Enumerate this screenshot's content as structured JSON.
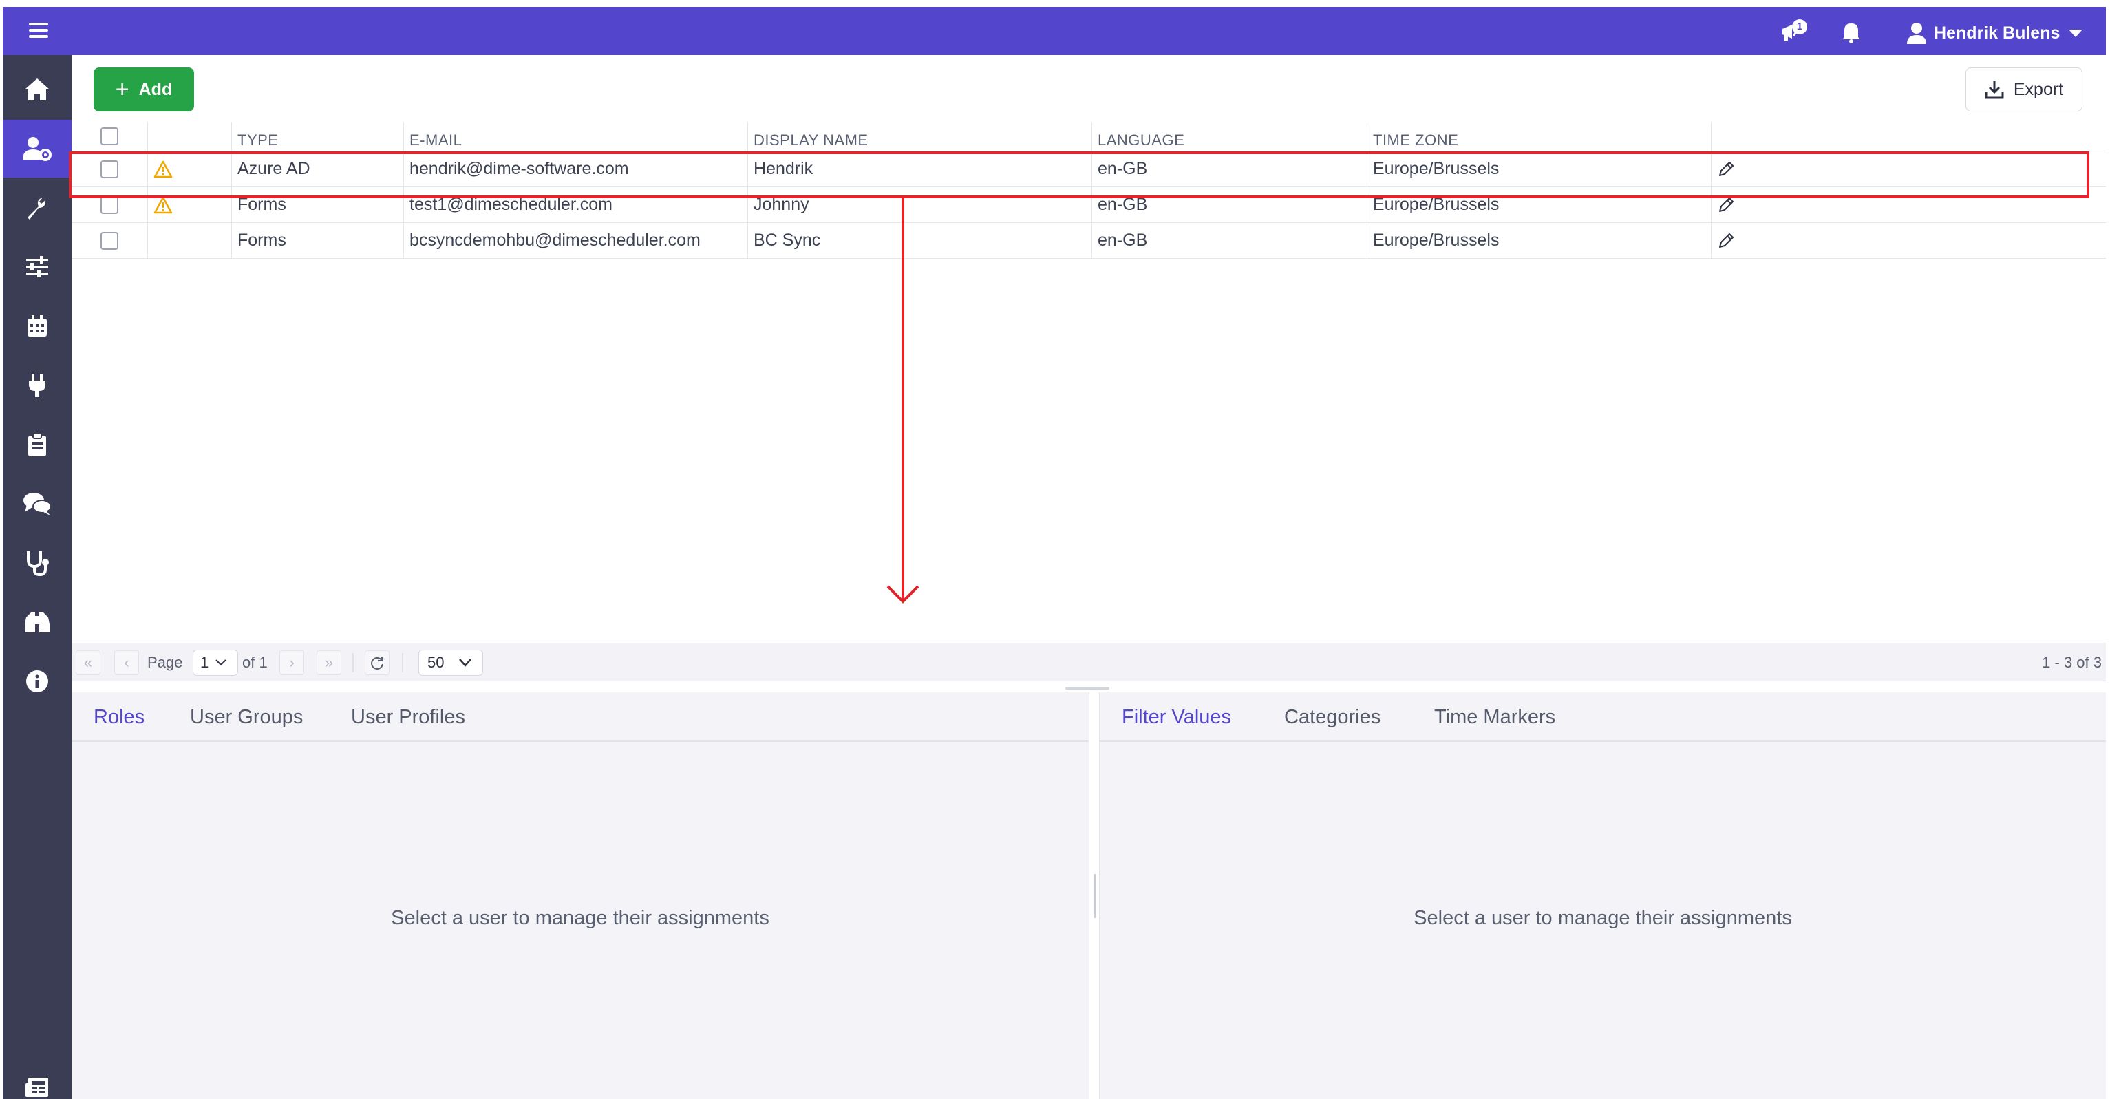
{
  "topbar": {
    "notification_count": "1",
    "user_name": "Hendrik Bulens",
    "brand_color": "#5446cc",
    "icons": [
      "menu-icon",
      "announcement-icon",
      "bell-icon",
      "user-icon",
      "caret-down-icon"
    ]
  },
  "sidebar": {
    "items": [
      {
        "icon": "home-icon",
        "active": false
      },
      {
        "icon": "user-settings-icon",
        "active": true
      },
      {
        "icon": "wrench-icon",
        "active": false
      },
      {
        "icon": "sliders-icon",
        "active": false
      },
      {
        "icon": "calendar-icon",
        "active": false
      },
      {
        "icon": "plug-icon",
        "active": false
      },
      {
        "icon": "clipboard-icon",
        "active": false
      },
      {
        "icon": "chat-icon",
        "active": false
      },
      {
        "icon": "stethoscope-icon",
        "active": false
      },
      {
        "icon": "binoculars-icon",
        "active": false
      },
      {
        "icon": "info-icon",
        "active": false
      },
      {
        "icon": "newspaper-icon",
        "active": false
      }
    ]
  },
  "toolbar": {
    "add_label": "Add",
    "export_label": "Export"
  },
  "grid": {
    "columns": [
      "TYPE",
      "E-MAIL",
      "DISPLAY NAME",
      "LANGUAGE",
      "TIME ZONE"
    ],
    "rows": [
      {
        "warning": true,
        "type": "Azure AD",
        "email": "hendrik@dime-software.com",
        "display_name": "Hendrik",
        "language": "en-GB",
        "time_zone": "Europe/Brussels"
      },
      {
        "warning": true,
        "type": "Forms",
        "email": "test1@dimescheduler.com",
        "display_name": "Johnny",
        "language": "en-GB",
        "time_zone": "Europe/Brussels"
      },
      {
        "warning": false,
        "type": "Forms",
        "email": "bcsyncdemohbu@dimescheduler.com",
        "display_name": "BC Sync",
        "language": "en-GB",
        "time_zone": "Europe/Brussels"
      }
    ]
  },
  "pager": {
    "page_label": "Page",
    "page_value": "1",
    "of_label": "of 1",
    "page_size": "50",
    "summary": "1 - 3 of 3"
  },
  "left_panel": {
    "tabs": [
      "Roles",
      "User Groups",
      "User Profiles"
    ],
    "active_tab": "Roles",
    "empty_message": "Select a user to manage their assignments"
  },
  "right_panel": {
    "tabs": [
      "Filter Values",
      "Categories",
      "Time Markers"
    ],
    "active_tab": "Filter Values",
    "empty_message": "Select a user to manage their assignments"
  },
  "annotation_color": "#e3252b"
}
